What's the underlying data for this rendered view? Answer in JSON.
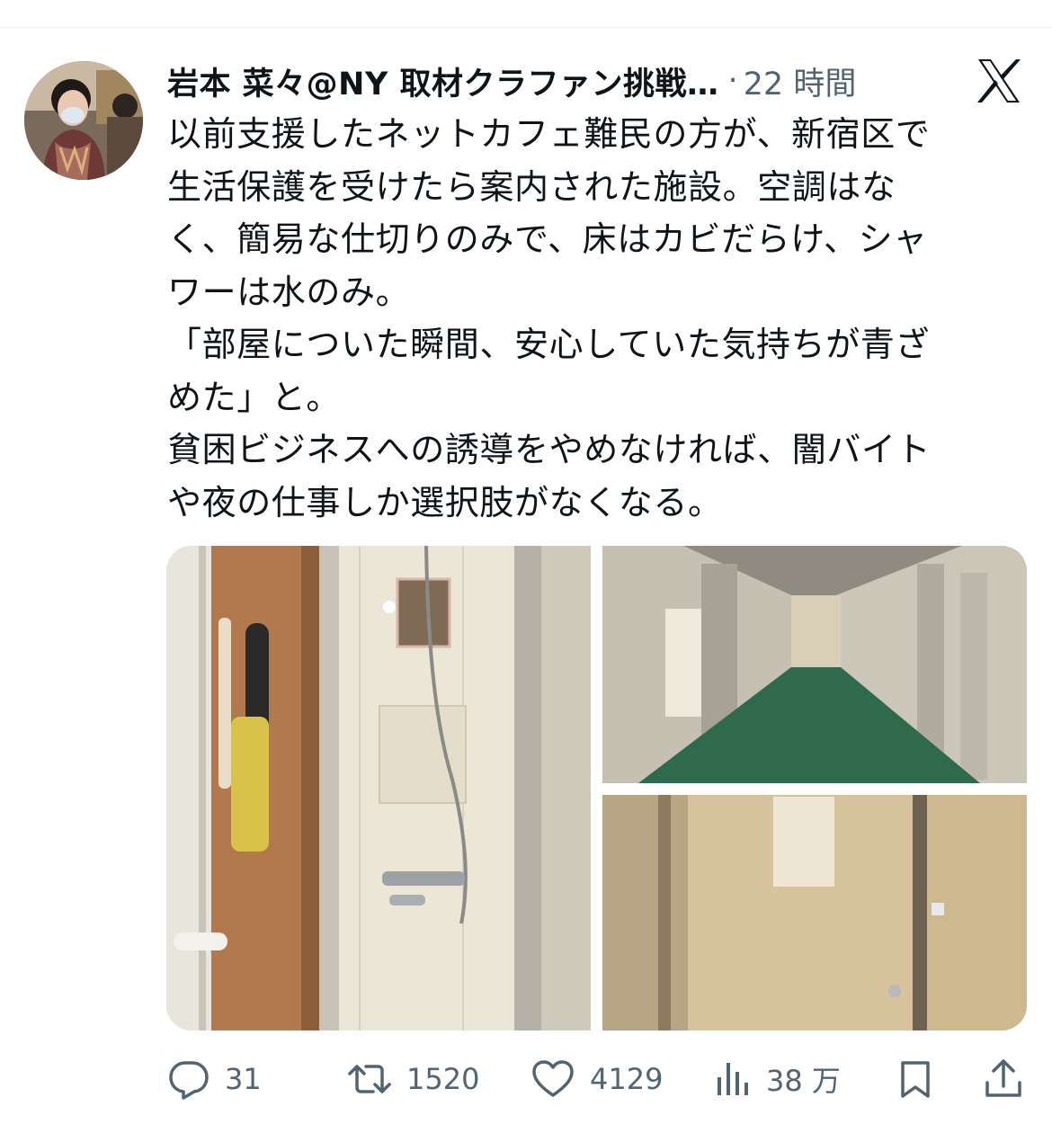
{
  "tweet": {
    "author_name": "岩本 菜々@NY 取材クラファン挑戦…",
    "separator": "·",
    "timestamp": "22 時間",
    "text": "以前支援したネットカフェ難民の方が、新宿区で\n生活保護を受けたら案内された施設。空調はな\nく、簡易な仕切りのみで、床はカビだらけ、シャ\nワーは水のみ。\n「部屋についた瞬間、安心していた気持ちが青ざ\nめた」と。\n貧困ビジネスへの誘導をやめなければ、闇バイト\nや夜の仕事しか選択肢がなくなる。"
  },
  "media": {
    "photos": [
      {
        "subject": "shower stall with scrub brush"
      },
      {
        "subject": "corridor with partition doors and green carpet"
      },
      {
        "subject": "stained partition wall with notice"
      }
    ]
  },
  "actions": {
    "reply_count": "31",
    "retweet_count": "1520",
    "like_count": "4129",
    "views_count": "38 万"
  },
  "icons": {
    "reply": "reply-icon",
    "retweet": "retweet-icon",
    "like": "heart-icon",
    "views": "views-icon",
    "bookmark": "bookmark-icon",
    "share": "share-icon",
    "brand": "x-logo-icon"
  },
  "colors": {
    "text": "#0f1419",
    "secondary": "#536471",
    "divider": "#eff3f4"
  }
}
